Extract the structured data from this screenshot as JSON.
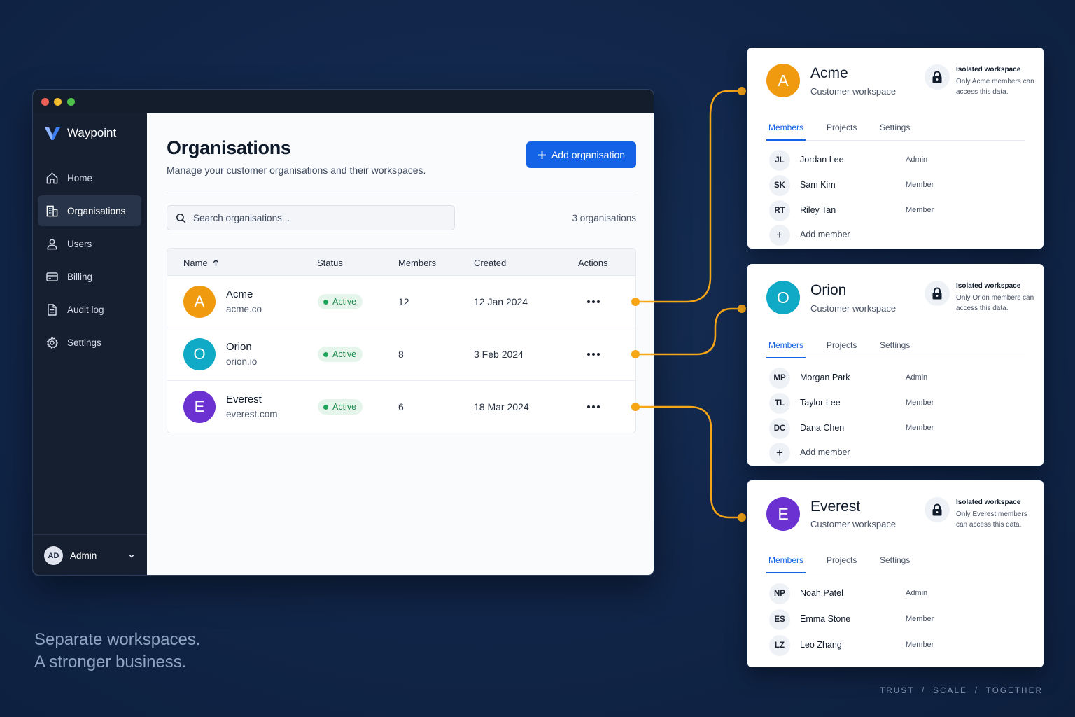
{
  "app": {
    "brand": "Waypoint",
    "nav": [
      {
        "label": "Home",
        "icon": "home-icon"
      },
      {
        "label": "Organisations",
        "icon": "building-icon",
        "active": true
      },
      {
        "label": "Users",
        "icon": "user-icon"
      },
      {
        "label": "Billing",
        "icon": "credit-card-icon"
      },
      {
        "label": "Audit log",
        "icon": "document-icon"
      },
      {
        "label": "Settings",
        "icon": "gear-icon"
      }
    ],
    "user": {
      "initials": "AD",
      "name": "Admin"
    }
  },
  "page": {
    "title": "Organisations",
    "subtitle": "Manage your customer organisations and their workspaces.",
    "add_button": "Add organisation",
    "search_placeholder": "Search organisations...",
    "count": "3 organisations"
  },
  "table": {
    "columns": {
      "name": "Name",
      "status": "Status",
      "members": "Members",
      "created": "Created",
      "actions": "Actions"
    },
    "rows": [
      {
        "initial": "A",
        "name": "Acme",
        "domain": "acme.co",
        "status": "Active",
        "members": "12",
        "created": "12 Jan 2024",
        "color": "#f09a0f"
      },
      {
        "initial": "O",
        "name": "Orion",
        "domain": "orion.io",
        "status": "Active",
        "members": "8",
        "created": "3 Feb 2024",
        "color": "#10a9c6"
      },
      {
        "initial": "E",
        "name": "Everest",
        "domain": "everest.com",
        "status": "Active",
        "members": "6",
        "created": "18 Mar 2024",
        "color": "#6b31d1"
      }
    ]
  },
  "workspaces": [
    {
      "initial": "A",
      "name": "Acme",
      "subtitle": "Customer workspace",
      "color": "#f09a0f",
      "isolation_title": "Isolated workspace",
      "isolation_text": "Only Acme members can access this data.",
      "tabs": [
        "Members",
        "Projects",
        "Settings"
      ],
      "members": [
        {
          "initials": "JL",
          "name": "Jordan Lee",
          "role": "Admin"
        },
        {
          "initials": "SK",
          "name": "Sam Kim",
          "role": "Member"
        },
        {
          "initials": "RT",
          "name": "Riley Tan",
          "role": "Member"
        }
      ],
      "add_member": "Add member"
    },
    {
      "initial": "O",
      "name": "Orion",
      "subtitle": "Customer workspace",
      "color": "#10a9c6",
      "isolation_title": "Isolated workspace",
      "isolation_text": "Only Orion members can access this data.",
      "tabs": [
        "Members",
        "Projects",
        "Settings"
      ],
      "members": [
        {
          "initials": "MP",
          "name": "Morgan Park",
          "role": "Admin"
        },
        {
          "initials": "TL",
          "name": "Taylor Lee",
          "role": "Member"
        },
        {
          "initials": "DC",
          "name": "Dana Chen",
          "role": "Member"
        }
      ],
      "add_member": "Add member"
    },
    {
      "initial": "E",
      "name": "Everest",
      "subtitle": "Customer workspace",
      "color": "#6b31d1",
      "isolation_title": "Isolated workspace",
      "isolation_text": "Only Everest members can access this data.",
      "tabs": [
        "Members",
        "Projects",
        "Settings"
      ],
      "members": [
        {
          "initials": "NP",
          "name": "Noah Patel",
          "role": "Admin"
        },
        {
          "initials": "ES",
          "name": "Emma Stone",
          "role": "Member"
        },
        {
          "initials": "LZ",
          "name": "Leo Zhang",
          "role": "Member"
        }
      ]
    }
  ],
  "tagline": {
    "line1": "Separate workspaces.",
    "line2": "A stronger business."
  },
  "footer": "TRUST  /  SCALE  /  TOGETHER",
  "colors": {
    "accent": "#1463e6",
    "connector": "#f5a516",
    "active": "#22a55a"
  }
}
